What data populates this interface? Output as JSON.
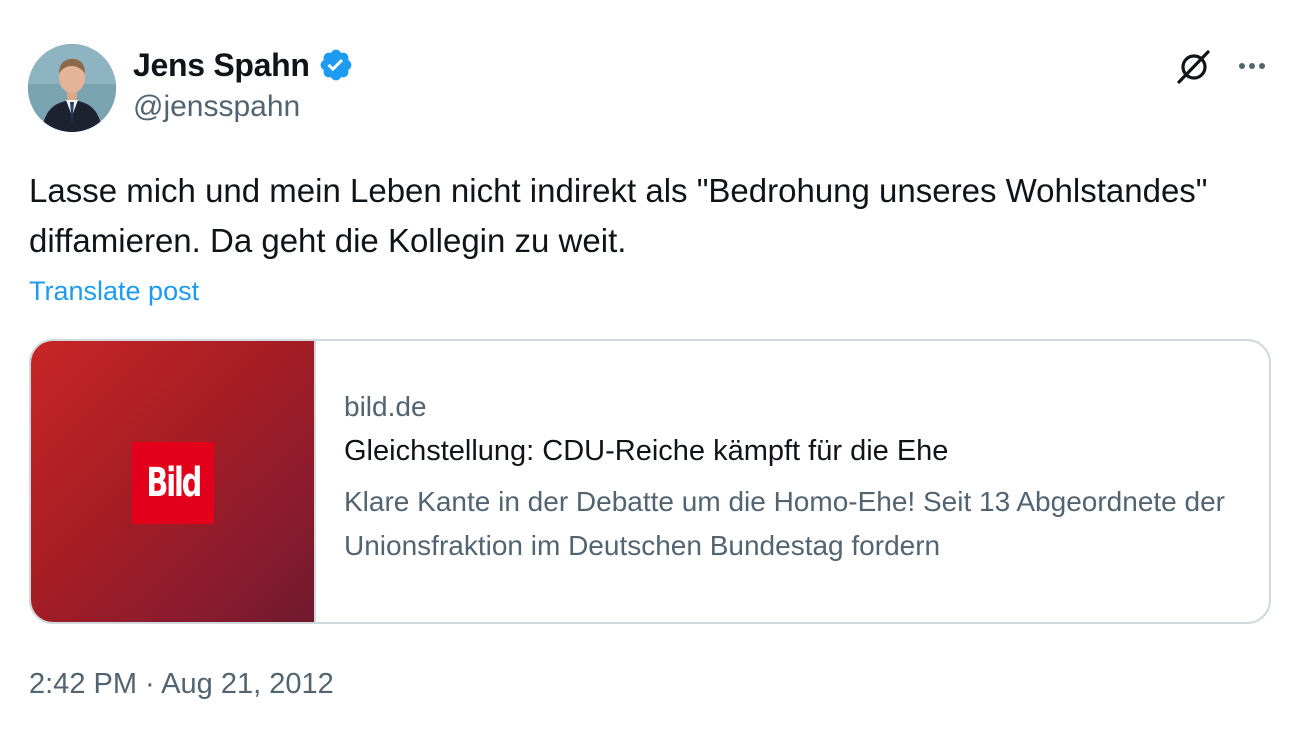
{
  "author": {
    "display_name": "Jens Spahn",
    "handle": "@jensspahn",
    "verified": true
  },
  "tweet": {
    "text": "Lasse mich und mein Leben nicht indirekt als \"Bedrohung unseres Wohlstandes\" diffamieren. Da geht die Kollegin zu weit.",
    "translate_label": "Translate post",
    "timestamp": "2:42 PM · Aug 21, 2012"
  },
  "link_card": {
    "logo_text": "Bild",
    "domain": "bild.de",
    "title": "Gleichstellung: CDU-Reiche kämpft für die Ehe",
    "description": "Klare Kante in der Debatte um die Homo-Ehe! Seit 13 Abgeordnete der Unionsfraktion im Deutschen Bundestag fordern"
  },
  "icons": {
    "verified": "verified-badge-icon",
    "grok": "grok-icon",
    "more": "more-options-icon"
  },
  "colors": {
    "accent": "#1d9bf0",
    "text_primary": "#0f1419",
    "text_secondary": "#536471",
    "border": "#cfd9de",
    "bild_red": "#e2001a"
  }
}
